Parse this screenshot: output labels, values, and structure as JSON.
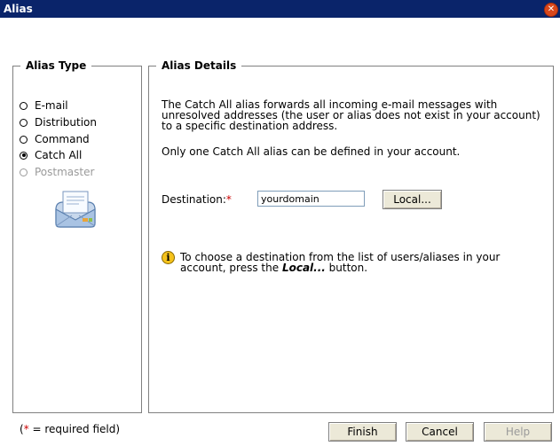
{
  "window": {
    "title": "Alias",
    "close_glyph": "✕"
  },
  "alias_type": {
    "heading": "Alias Type",
    "options": [
      {
        "label": "E-mail",
        "checked": false,
        "disabled": false
      },
      {
        "label": "Distribution",
        "checked": false,
        "disabled": false
      },
      {
        "label": "Command",
        "checked": false,
        "disabled": false
      },
      {
        "label": "Catch All",
        "checked": true,
        "disabled": false
      },
      {
        "label": "Postmaster",
        "checked": false,
        "disabled": true
      }
    ],
    "icon": "mail-envelope-icon"
  },
  "alias_details": {
    "heading": "Alias Details",
    "description_lines": [
      "The Catch All alias forwards all incoming e-mail messages with",
      "unresolved addresses (the user or alias does not exist in your account)",
      "to a specific destination address."
    ],
    "note": "Only one Catch All alias can be defined in your account.",
    "destination_label": "Destination:",
    "required_mark": "*",
    "destination_value": "yourdomain",
    "local_button": "Local...",
    "info_lines": {
      "line1": "To choose a destination from the list of users/aliases in your",
      "line2_prefix": "account, press the ",
      "line2_emphasis": "Local...",
      "line2_suffix": " button."
    }
  },
  "footer": {
    "required_mark": "*",
    "required_text": " = required field)",
    "required_open": "(",
    "finish": "Finish",
    "cancel": "Cancel",
    "help": "Help"
  },
  "colors": {
    "title_bar": "#0a246a",
    "required": "#cc0000",
    "info_icon": "#f5c21b"
  }
}
